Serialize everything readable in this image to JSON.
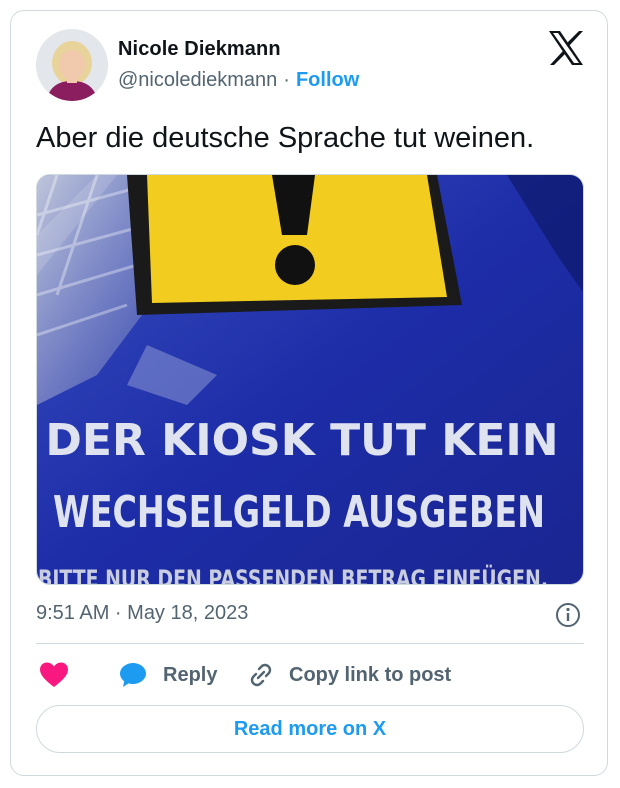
{
  "author": {
    "name": "Nicole Diekmann",
    "handle": "@nicolediekmann",
    "separator": "·",
    "follow_label": "Follow"
  },
  "tweet": {
    "text": "Aber die deutsche Sprache tut weinen.",
    "timestamp": "9:51 AM · May 18, 2023"
  },
  "media": {
    "sign_line1": "DER KIOSK TUT KEIN",
    "sign_line2": "WECHSELGELD AUSGEBEN",
    "sign_line3": "BITTE NUR DEN PASSENDEN BETRAG EINFÜGEN."
  },
  "actions": {
    "like_icon": "heart-icon",
    "reply_label": "Reply",
    "copy_label": "Copy link to post",
    "read_more_label": "Read more on X"
  },
  "colors": {
    "accent": "#1d9bf0",
    "like": "#f91880",
    "muted_text": "#536471",
    "sign_blue": "#1f2fa8",
    "warning_yellow": "#f2cc1f"
  }
}
